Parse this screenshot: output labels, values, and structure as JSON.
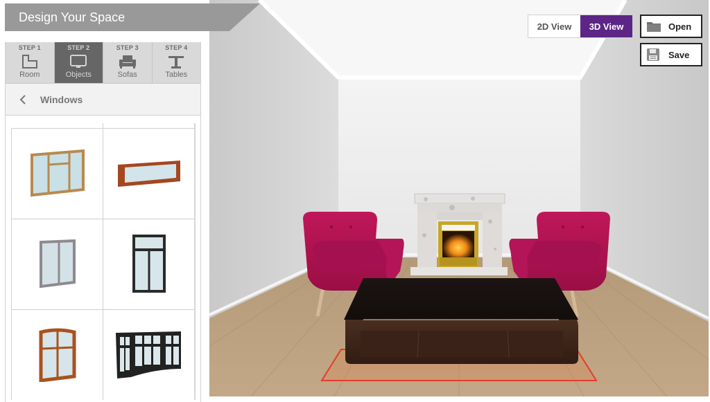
{
  "app": {
    "title": "Design Your Space"
  },
  "steps": [
    {
      "step": "STEP 1",
      "label": "Room",
      "icon": "room-icon",
      "active": false
    },
    {
      "step": "STEP 2",
      "label": "Objects",
      "icon": "monitor-icon",
      "active": true
    },
    {
      "step": "STEP 3",
      "label": "Sofas",
      "icon": "sofa-icon",
      "active": false
    },
    {
      "step": "STEP 4",
      "label": "Tables",
      "icon": "table-icon",
      "active": false
    }
  ],
  "category": {
    "title": "Windows",
    "back_icon": "chevron-left-icon"
  },
  "catalog": [
    {
      "name": "window-casement-transom-oak",
      "frame": "#b98a4e"
    },
    {
      "name": "window-wide-fixed-cherry",
      "frame": "#a4471f"
    },
    {
      "name": "window-double-hung-grey",
      "frame": "#8f8a8f"
    },
    {
      "name": "window-french-transom-black",
      "frame": "#2a2a2a"
    },
    {
      "name": "window-arched-mullion-cherry",
      "frame": "#a9521e"
    },
    {
      "name": "window-bay-black",
      "frame": "#222222"
    }
  ],
  "view_toggle": {
    "options": [
      "2D View",
      "3D View"
    ],
    "selected": "3D View"
  },
  "actions": {
    "open_label": "Open",
    "save_label": "Save"
  },
  "colors": {
    "accent": "#5c2586",
    "banner": "#999999",
    "active_step": "#666666",
    "chair": "#b0134f",
    "table": "#3b2418",
    "selection_outline": "#e53b2b"
  },
  "scene": {
    "objects": [
      "armchair-left",
      "fireplace",
      "armchair-right",
      "coffee-table"
    ],
    "selected_object": "coffee-table"
  }
}
